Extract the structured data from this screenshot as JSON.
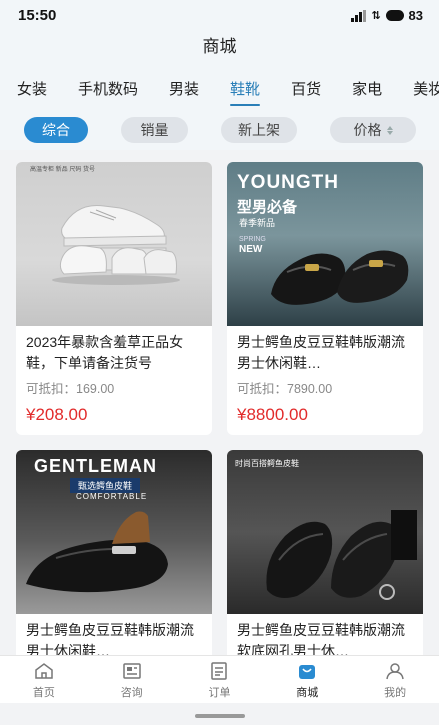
{
  "status_bar": {
    "time": "15:50",
    "battery": "83"
  },
  "header": {
    "title": "商城"
  },
  "categories": [
    {
      "label": "女装"
    },
    {
      "label": "手机数码"
    },
    {
      "label": "男装"
    },
    {
      "label": "鞋靴",
      "active": true
    },
    {
      "label": "百货"
    },
    {
      "label": "家电"
    },
    {
      "label": "美妆"
    }
  ],
  "sort": {
    "overall": "综合",
    "sales": "销量",
    "new_arrivals": "新上架",
    "price": "价格"
  },
  "products": [
    {
      "name": "2023年暴款含羞草正品女鞋，下单请备注货号",
      "deduct": "可抵扣：169.00",
      "price": "¥208.00",
      "image_text": "高温专柜 新品 尺码 货号"
    },
    {
      "name": "男士鳄鱼皮豆豆鞋韩版潮流男士休闲鞋…",
      "deduct": "可抵扣：7890.00",
      "price": "¥8800.00",
      "image_text": {
        "headline": "YOUNGTH",
        "sub1": "型男必备",
        "sub2": "春季新品",
        "sub3": "SPRING",
        "sub4": "NEW"
      }
    },
    {
      "name": "男士鳄鱼皮豆豆鞋韩版潮流男士休闲鞋…",
      "image_text": {
        "headline": "GENTLEMAN",
        "sub1": "甄选鳄鱼皮鞋",
        "sub2": "COMFORTABLE"
      }
    },
    {
      "name": "男士鳄鱼皮豆豆鞋韩版潮流软底网孔男士休…",
      "image_text": {
        "headline": "时尚百搭鳄鱼皮鞋"
      }
    }
  ],
  "tabbar": [
    {
      "label": "首页",
      "icon": "home-icon"
    },
    {
      "label": "咨询",
      "icon": "news-icon"
    },
    {
      "label": "订单",
      "icon": "order-icon"
    },
    {
      "label": "商城",
      "icon": "shop-icon",
      "active": true
    },
    {
      "label": "我的",
      "icon": "user-icon"
    }
  ],
  "colors": {
    "accent": "#2a8bd1",
    "price": "#e22b2b",
    "tab_active": "#2a7fb8"
  }
}
